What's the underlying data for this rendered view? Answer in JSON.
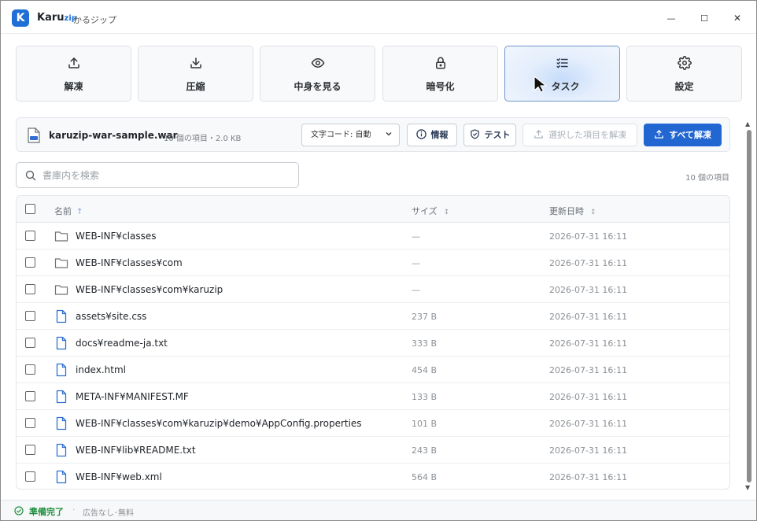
{
  "window": {
    "logo_letter": "K",
    "app_name": "Karu",
    "app_name_suffix": "zip",
    "app_subtitle": "かるジップ",
    "min_glyph": "—",
    "max_glyph": "☐",
    "close_glyph": "✕"
  },
  "toolbar": {
    "items": [
      {
        "label": "解凍",
        "icon": "upload-icon"
      },
      {
        "label": "圧縮",
        "icon": "download-icon"
      },
      {
        "label": "中身を見る",
        "icon": "eye-icon"
      },
      {
        "label": "暗号化",
        "icon": "lock-icon"
      },
      {
        "label": "タスク",
        "icon": "task-list-icon",
        "active": true
      },
      {
        "label": "設定",
        "icon": "gear-icon"
      }
    ]
  },
  "archive": {
    "filename": "karuzip-war-sample.war",
    "meta": "10 個の項目・2.0 KB",
    "encoding_value": "文字コード: 自動",
    "info_label": "情報",
    "test_label": "テスト",
    "extract_selected_label": "選択した項目を解凍",
    "extract_all_label": "すべて解凍"
  },
  "search": {
    "placeholder": "書庫内を検索",
    "value": ""
  },
  "item_count": "10 個の項目",
  "table": {
    "headers": {
      "name": "名前",
      "name_sort": "↑",
      "size": "サイズ",
      "size_sort": "↕",
      "date": "更新日時",
      "date_sort": "↕"
    },
    "rows": [
      {
        "type": "folder",
        "name": "WEB-INF¥classes",
        "size": "—",
        "date": "2026-07-31 16:11"
      },
      {
        "type": "folder",
        "name": "WEB-INF¥classes¥com",
        "size": "—",
        "date": "2026-07-31 16:11"
      },
      {
        "type": "folder",
        "name": "WEB-INF¥classes¥com¥karuzip",
        "size": "—",
        "date": "2026-07-31 16:11"
      },
      {
        "type": "file",
        "name": "assets¥site.css",
        "size": "237 B",
        "date": "2026-07-31 16:11"
      },
      {
        "type": "file",
        "name": "docs¥readme-ja.txt",
        "size": "333 B",
        "date": "2026-07-31 16:11"
      },
      {
        "type": "file",
        "name": "index.html",
        "size": "454 B",
        "date": "2026-07-31 16:11"
      },
      {
        "type": "file",
        "name": "META-INF¥MANIFEST.MF",
        "size": "133 B",
        "date": "2026-07-31 16:11"
      },
      {
        "type": "file",
        "name": "WEB-INF¥classes¥com¥karuzip¥demo¥AppConfig.properties",
        "size": "101 B",
        "date": "2026-07-31 16:11"
      },
      {
        "type": "file",
        "name": "WEB-INF¥lib¥README.txt",
        "size": "243 B",
        "date": "2026-07-31 16:11"
      },
      {
        "type": "file",
        "name": "WEB-INF¥web.xml",
        "size": "564 B",
        "date": "2026-07-31 16:11"
      }
    ]
  },
  "status": {
    "text": "準備完了",
    "separator": "·",
    "ad_text": "広告なし･無料"
  },
  "colors": {
    "accent": "#2166d1",
    "folder_icon": "#6b7178",
    "file_icon": "#2f6fd0",
    "status_ok": "#1e8e3e"
  }
}
